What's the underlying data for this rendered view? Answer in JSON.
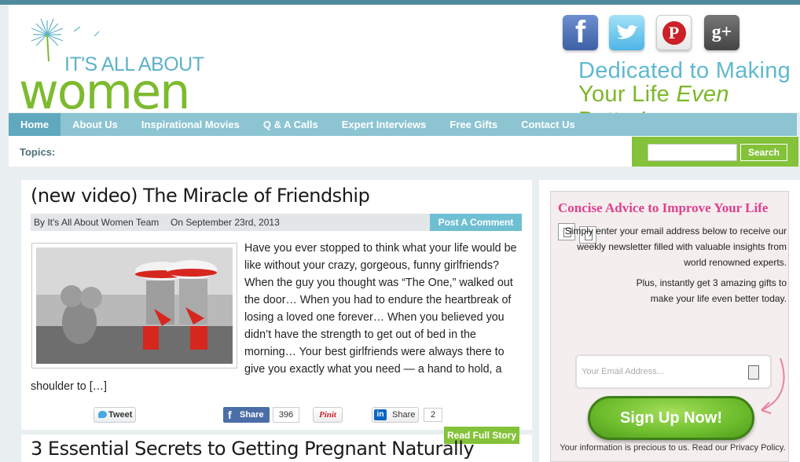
{
  "logo": {
    "line1": "IT'S ALL ABOUT",
    "line2": "women"
  },
  "social": [
    {
      "name": "facebook",
      "glyph": "f"
    },
    {
      "name": "twitter",
      "glyph": ""
    },
    {
      "name": "pinterest",
      "glyph": "P"
    },
    {
      "name": "google-plus",
      "glyph": "g+"
    }
  ],
  "tagline": {
    "line1": "Dedicated to Making",
    "line2_pre": "Your Life ",
    "line2_em": "Even",
    "line2_post": " Better!"
  },
  "nav": [
    "Home",
    "About Us",
    "Inspirational Movies",
    "Q & A Calls",
    "Expert Interviews",
    "Free Gifts",
    "Contact Us"
  ],
  "topics": {
    "label": "Topics:",
    "search_button": "Search"
  },
  "post": {
    "title": "(new video) The Miracle of Friendship",
    "author": "By It's All About Women Team",
    "date": "On September 23rd, 2013",
    "comment": "Post A Comment",
    "excerpt": "Have you ever stopped to think what your life would be like without your crazy, gorgeous, funny girlfriends? When the guy you thought was “The One,” walked out the door… When you had to endure the heartbreak of losing a loved one forever… When you believed you didn’t have the strength to get out of bed in the morning… Your best girlfriends were always there to give you exactly what you need — a hand to hold, a shoulder to […]",
    "share": {
      "tweet": "Tweet",
      "fb_share": "Share",
      "fb_count": "396",
      "pin": "Pinit",
      "in_share": "Share",
      "in_count": "2"
    },
    "read_more": "Read Full Story"
  },
  "post2": {
    "title": "3 Essential Secrets to Getting Pregnant Naturally"
  },
  "optin": {
    "title": "Concise Advice to Improve Your Life",
    "text1": "Simply enter your email address below to receive our weekly newsletter filled with valuable insights from world renowned experts.",
    "text2": "Plus, instantly get 3 amazing gifts to make your life even better today.",
    "email_placeholder": "Your Email Address...",
    "button": "Sign Up Now!",
    "privacy": "Your information is precious to us. Read our Privacy Policy."
  },
  "colors": {
    "accent_blue": "#8cc4d2",
    "accent_green": "#84c23a",
    "pink": "#e0408e"
  }
}
